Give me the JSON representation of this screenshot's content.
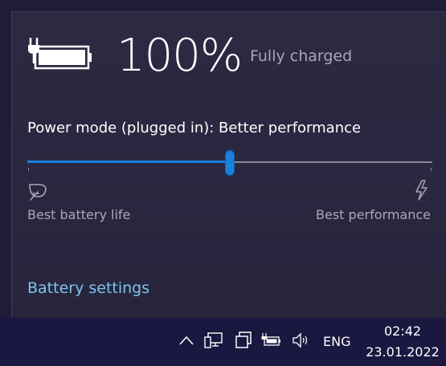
{
  "battery": {
    "percent_text": "100%",
    "status": "Fully charged",
    "icon": "plugged-battery-icon"
  },
  "power_mode": {
    "label": "Power mode (plugged in): Better performance",
    "slider_level": 0.5,
    "left_label": "Best battery life",
    "right_label": "Best performance",
    "left_icon": "leaf-icon",
    "right_icon": "lightning-bolt-icon"
  },
  "links": {
    "battery_settings": "Battery settings"
  },
  "taskbar": {
    "tray_icons": [
      "chevron-up-icon",
      "network-icon",
      "task-view-icon",
      "battery-icon",
      "volume-icon"
    ],
    "language": "ENG",
    "time": "02:42",
    "date": "23.01.2022"
  },
  "colors": {
    "accent": "#1b7fdc",
    "link": "#7fc4ec",
    "panel": "#2a2840",
    "taskbar": "#1a1740"
  }
}
